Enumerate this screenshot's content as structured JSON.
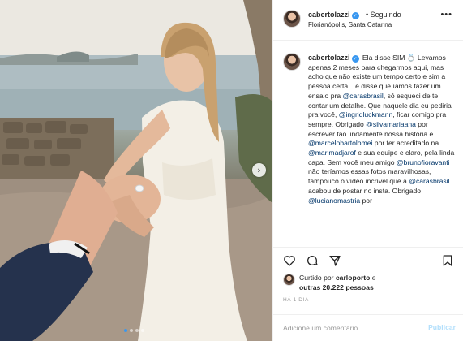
{
  "photo": {
    "alt_subject": "photo",
    "carousel": {
      "count": 4,
      "active_index": 1
    }
  },
  "header": {
    "username": "cabertolazzi",
    "follow_status": "• Seguindo",
    "location": "Florianópolis, Santa Catarina",
    "more_icon": "more-horizontal-icon"
  },
  "caption": {
    "username": "cabertolazzi",
    "segments": [
      {
        "text": "Ela disse SIM 💍 Levamos apenas 2 meses para chegarmos aqui, mas acho que não existe um tempo certo e sim a pessoa certa. Te disse que íamos fazer um ensaio pra ",
        "mention": false
      },
      {
        "text": "@carasbrasil",
        "mention": true
      },
      {
        "text": ", só esqueci de te contar um detalhe. Que naquele dia eu pediria pra você, ",
        "mention": false
      },
      {
        "text": "@ingridluckmann",
        "mention": true
      },
      {
        "text": ", ficar comigo pra sempre. Obrigado ",
        "mention": false
      },
      {
        "text": "@silvamariaana",
        "mention": true
      },
      {
        "text": " por escrever tão lindamente nossa história e ",
        "mention": false
      },
      {
        "text": "@marcelobartolomei",
        "mention": true
      },
      {
        "text": " por ter acreditado na ",
        "mention": false
      },
      {
        "text": "@marimadjarof",
        "mention": true
      },
      {
        "text": " e sua equipe e claro, pela linda capa. Sem você meu amigo ",
        "mention": false
      },
      {
        "text": "@brunofioravanti",
        "mention": true
      },
      {
        "text": " não teríamos essas fotos maravilhosas, tampouco o vídeo incrível que a ",
        "mention": false
      },
      {
        "text": "@carasbrasil",
        "mention": true
      },
      {
        "text": " acabou de postar no insta. Obrigado ",
        "mention": false
      },
      {
        "text": "@lucianomastria",
        "mention": true
      },
      {
        "text": " por",
        "mention": false
      }
    ]
  },
  "actions": {
    "like_icon": "heart-icon",
    "comment_icon": "comment-icon",
    "share_icon": "share-icon",
    "save_icon": "bookmark-icon"
  },
  "likes": {
    "prefix": "Curtido por ",
    "first_user": "carloporto",
    "middle": " e",
    "others": "outras 20.222 pessoas"
  },
  "time": "HÁ 1 DIA",
  "comment": {
    "placeholder": "Adicione um comentário...",
    "publish_label": "Publicar"
  },
  "colors": {
    "accent": "#3897f0",
    "mention": "#003569",
    "publish_disabled": "#b2dffc"
  }
}
